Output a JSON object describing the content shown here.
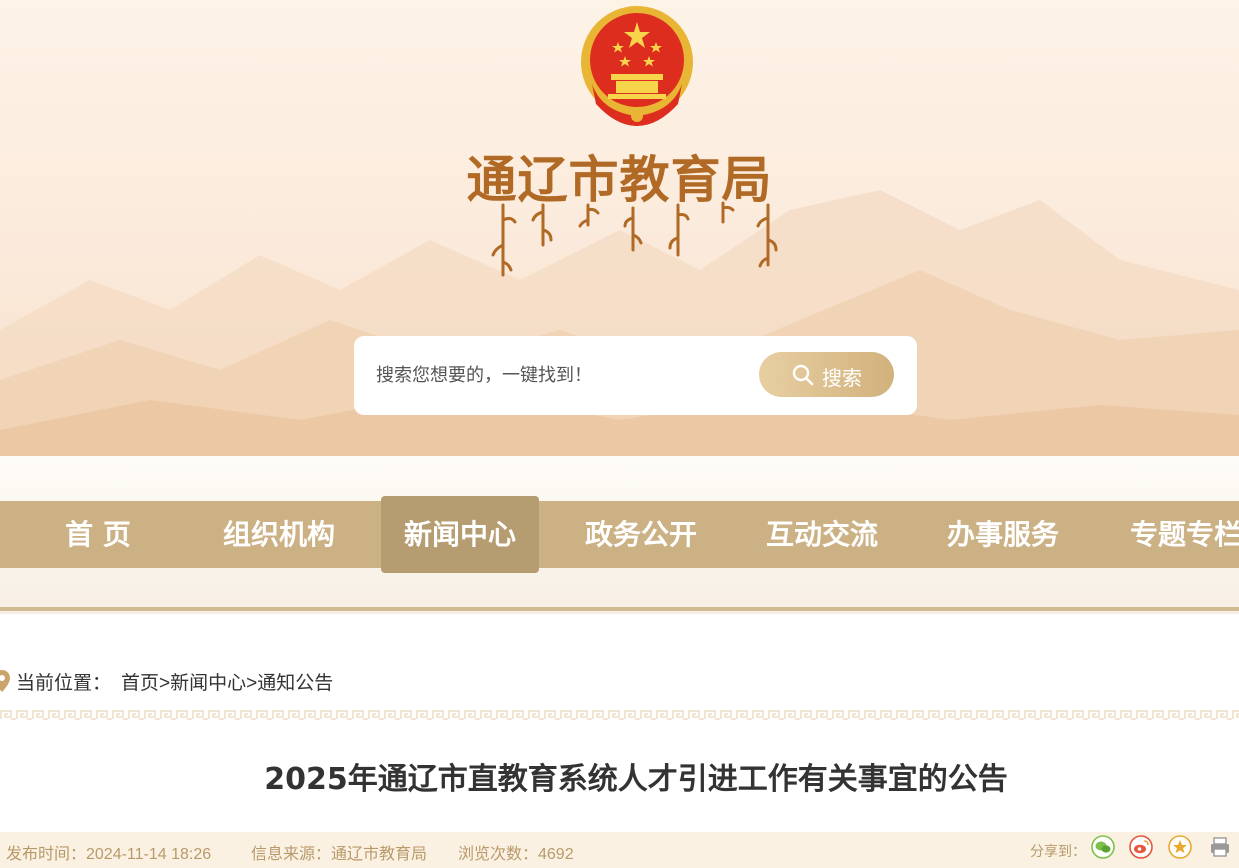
{
  "header": {
    "emblem_icon": "national-emblem-icon",
    "site_title": "通辽市教育局",
    "brand_color": "#b06a25"
  },
  "search": {
    "placeholder": "搜索您想要的，一键找到！",
    "button_label": "搜索",
    "button_icon": "search-icon"
  },
  "nav": {
    "items": [
      {
        "label": "首 页"
      },
      {
        "label": "组织机构"
      },
      {
        "label": "新闻中心",
        "active": true
      },
      {
        "label": "政务公开"
      },
      {
        "label": "互动交流"
      },
      {
        "label": "办事服务"
      },
      {
        "label": "专题专栏"
      }
    ],
    "bar_color": "#ccb185",
    "active_color": "#b59c71"
  },
  "breadcrumb": {
    "prefix": "当前位置：",
    "home": "首页",
    "sep": ">",
    "section": "新闻中心",
    "page": "通知公告"
  },
  "article": {
    "title": "2025年通辽市直教育系统人才引进工作有关事宜的公告",
    "publish_time": "发布时间：2024-11-14 18:26",
    "source": "信息来源：通辽市教育局",
    "views": "浏览次数：4692"
  },
  "share": {
    "label": "分享到：",
    "icons": [
      "wechat-icon",
      "weibo-icon",
      "favorite-icon",
      "print-icon"
    ]
  }
}
